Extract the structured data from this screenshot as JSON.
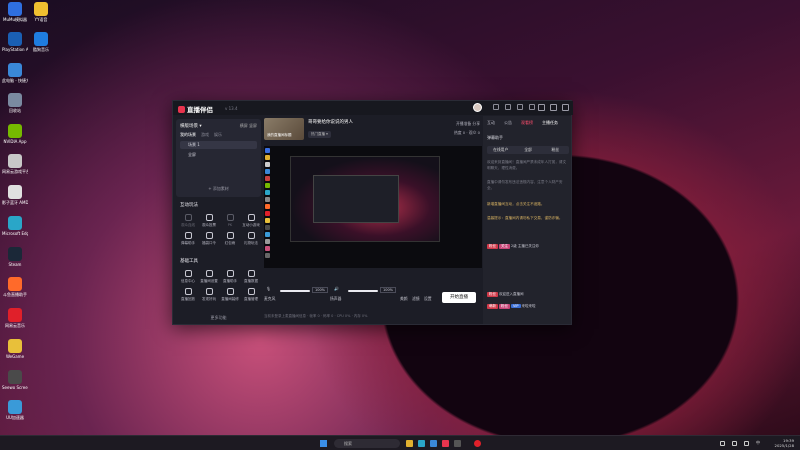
{
  "desktop": {
    "icons": [
      {
        "label": "MuMu模拟器",
        "color": "#2f6fe0"
      },
      {
        "label": "YY语音",
        "color": "#f0c030"
      },
      {
        "label": "PlayStation Accessories",
        "color": "#1a5fb4"
      },
      {
        "label": "酷狗音乐",
        "color": "#1f7de0"
      },
      {
        "label": "此电脑 - 快捷方式",
        "color": "#3a88d8"
      },
      {
        "label": "回收站",
        "color": "#7a8aa0"
      },
      {
        "label": "NVIDIA App",
        "color": "#76b900"
      },
      {
        "label": "网易云游戏平台",
        "color": "#c8c8c8"
      },
      {
        "label": "影子蓝牙 AMD",
        "color": "#e0e0e0"
      },
      {
        "label": "Microsoft Edge",
        "color": "#2aa6c8"
      },
      {
        "label": "Steam",
        "color": "#1b2838"
      },
      {
        "label": "斗鱼直播助手",
        "color": "#ff6a2a"
      },
      {
        "label": "网易云音乐",
        "color": "#e0202a"
      },
      {
        "label": "WeGame",
        "color": "#e8c03a"
      },
      {
        "label": "Seewo Screen",
        "color": "#4a4a4a"
      },
      {
        "label": "UU加速器",
        "color": "#3a9ad8"
      }
    ]
  },
  "app": {
    "name": "直播伴侣",
    "version": "v 13.4",
    "title_icons": [
      "message-icon",
      "chat-icon",
      "skin-icon",
      "menu-icon",
      "minimize-icon",
      "maximize-icon",
      "close-icon"
    ]
  },
  "left": {
    "scene_title": "横版场景 ▾",
    "scene_right": [
      "横屏",
      "竖屏"
    ],
    "scene_tabs": [
      "我的场景",
      "游戏",
      "娱乐"
    ],
    "scene_items": [
      "场景 1",
      "全屏"
    ],
    "scene_add": "+ 添加素材",
    "interact_title": "互动玩法",
    "interact_tools": [
      {
        "label": "观众连线",
        "dim": true
      },
      {
        "label": "观众投票",
        "dim": false
      },
      {
        "label": "PK",
        "dim": true
      },
      {
        "label": "互动小游戏",
        "dim": false
      },
      {
        "label": "弹幕助手",
        "dim": false
      },
      {
        "label": "福袋口令",
        "dim": false
      },
      {
        "label": "红包雨",
        "dim": false
      },
      {
        "label": "礼物玩法",
        "dim": false
      }
    ],
    "basic_title": "基础工具",
    "basic_tools": [
      {
        "label": "信息中心",
        "dim": false
      },
      {
        "label": "直播间设置",
        "dim": false
      },
      {
        "label": "直播助手",
        "dim": false
      },
      {
        "label": "直播数据",
        "dim": false
      },
      {
        "label": "直播回放",
        "dim": false
      },
      {
        "label": "发现好玩",
        "dim": false
      },
      {
        "label": "直播间装修",
        "dim": false
      },
      {
        "label": "直播管理",
        "dim": false
      }
    ],
    "more": "更多功能"
  },
  "center": {
    "cover_label": "我的直播间标题",
    "room_title": "哥哥要给你说说的男人",
    "room_tag": "热门直播 ▾",
    "right_lines": [
      "开播准备   分享",
      "热度 0   · 观众 0"
    ],
    "controls": {
      "mic_label": "麦克风",
      "mic_pct": "100%",
      "speaker_label": "扬声器",
      "speaker_pct": "100%",
      "extra": [
        "美颜",
        "滤镜",
        "设置"
      ]
    },
    "go_live": "开始直播",
    "status": "当前未登录上麦直播间信息 · 帧率 0 · 码率 0 · CPU 0% · 内存 0%"
  },
  "right": {
    "tabs": [
      "互动",
      "公告",
      "观看榜",
      "主播任务",
      "评论"
    ],
    "assistant_title": "弹幕助手",
    "segments": [
      "在线用户",
      "全部",
      "粉丝"
    ],
    "messages": [
      {
        "text": "欢迎来到直播间！直播间严禁未成年人打赏，请文明聊天，理性消费。",
        "gold": false
      },
      {
        "text": "直播中请勿发布违法违规内容，注意个人财产安全。",
        "gold": false
      },
      {
        "text": "新增直播间互动，点击关注不迷路。",
        "gold": true
      },
      {
        "text": "温馨提示：直播间内请勿私下交易，谨防诈骗。",
        "gold": true
      }
    ],
    "chat": [
      {
        "badges": [
          "粉丝",
          "关注"
        ],
        "text": "2级  主播已关注你"
      },
      {
        "badges": [
          "粉丝"
        ],
        "text": "欢迎进入直播间"
      },
      {
        "badges": [
          "萌新",
          "粉丝",
          "VIP"
        ],
        "text": "来啦来啦"
      }
    ]
  },
  "taskbar": {
    "search_placeholder": "搜索",
    "clock_time": "19:39",
    "clock_date": "2025/1/28",
    "tray_text": "中"
  }
}
